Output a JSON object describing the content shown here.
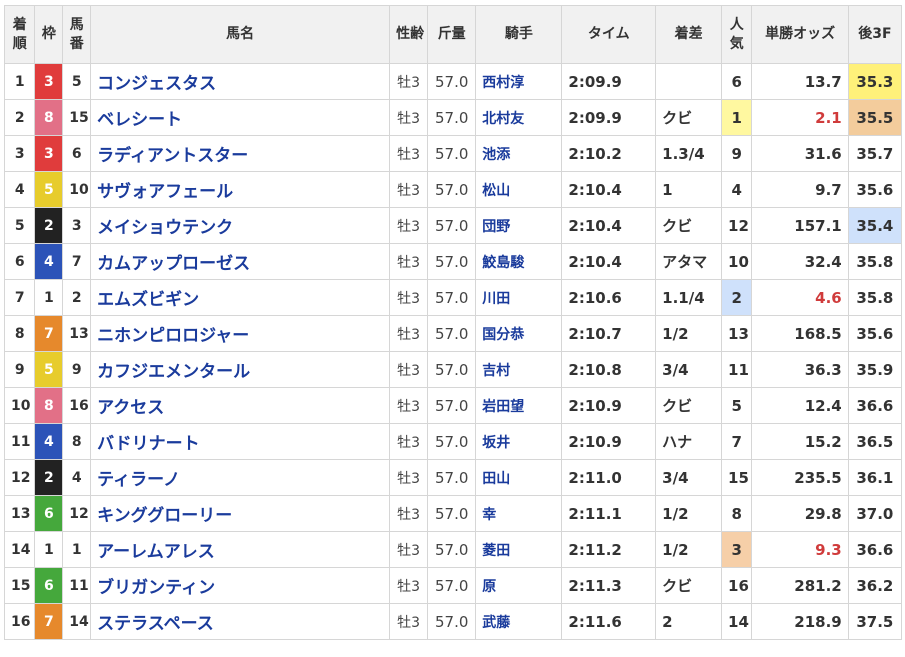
{
  "headers": {
    "rank": "着順",
    "waku": "枠",
    "num": "馬番",
    "name": "馬名",
    "sex_age": "性齢",
    "weight": "斤量",
    "jockey": "騎手",
    "time": "タイム",
    "margin": "着差",
    "popularity": "人気",
    "odds": "単勝オッズ",
    "last3f": "後3F"
  },
  "waku_colors": {
    "1": {
      "bg": "#ffffff",
      "fg": "#333333"
    },
    "2": {
      "bg": "#222222",
      "fg": "#ffffff"
    },
    "3": {
      "bg": "#e03c3c",
      "fg": "#ffffff"
    },
    "4": {
      "bg": "#2c53b8",
      "fg": "#ffffff"
    },
    "5": {
      "bg": "#e7cc2c",
      "fg": "#ffffff"
    },
    "6": {
      "bg": "#45a83c",
      "fg": "#ffffff"
    },
    "7": {
      "bg": "#e6892c",
      "fg": "#ffffff"
    },
    "8": {
      "bg": "#e27087",
      "fg": "#ffffff"
    }
  },
  "rows": [
    {
      "rank": "1",
      "waku": "3",
      "num": "5",
      "name": "コンジェスタス",
      "sex_age": "牡3",
      "weight": "57.0",
      "jockey": "西村淳",
      "time": "2:09.9",
      "margin": "",
      "popularity": "6",
      "odds": "13.7",
      "last3f": "35.3",
      "last_rank": 1
    },
    {
      "rank": "2",
      "waku": "8",
      "num": "15",
      "name": "ベレシート",
      "sex_age": "牡3",
      "weight": "57.0",
      "jockey": "北村友",
      "time": "2:09.9",
      "margin": "クビ",
      "popularity": "1",
      "odds": "2.1",
      "last3f": "35.5",
      "last_rank": 2
    },
    {
      "rank": "3",
      "waku": "3",
      "num": "6",
      "name": "ラディアントスター",
      "sex_age": "牡3",
      "weight": "57.0",
      "jockey": "池添",
      "time": "2:10.2",
      "margin": "1.3/4",
      "popularity": "9",
      "odds": "31.6",
      "last3f": "35.7",
      "last_rank": 0
    },
    {
      "rank": "4",
      "waku": "5",
      "num": "10",
      "name": "サヴォアフェール",
      "sex_age": "牡3",
      "weight": "57.0",
      "jockey": "松山",
      "time": "2:10.4",
      "margin": "1",
      "popularity": "4",
      "odds": "9.7",
      "last3f": "35.6",
      "last_rank": 0
    },
    {
      "rank": "5",
      "waku": "2",
      "num": "3",
      "name": "メイショウテンク",
      "sex_age": "牡3",
      "weight": "57.0",
      "jockey": "団野",
      "time": "2:10.4",
      "margin": "クビ",
      "popularity": "12",
      "odds": "157.1",
      "last3f": "35.4",
      "last_rank": 3
    },
    {
      "rank": "6",
      "waku": "4",
      "num": "7",
      "name": "カムアップローゼス",
      "sex_age": "牡3",
      "weight": "57.0",
      "jockey": "鮫島駿",
      "time": "2:10.4",
      "margin": "アタマ",
      "popularity": "10",
      "odds": "32.4",
      "last3f": "35.8",
      "last_rank": 0
    },
    {
      "rank": "7",
      "waku": "1",
      "num": "2",
      "name": "エムズビギン",
      "sex_age": "牡3",
      "weight": "57.0",
      "jockey": "川田",
      "time": "2:10.6",
      "margin": "1.1/4",
      "popularity": "2",
      "odds": "4.6",
      "last3f": "35.8",
      "last_rank": 0
    },
    {
      "rank": "8",
      "waku": "7",
      "num": "13",
      "name": "ニホンピロロジャー",
      "sex_age": "牡3",
      "weight": "57.0",
      "jockey": "国分恭",
      "time": "2:10.7",
      "margin": "1/2",
      "popularity": "13",
      "odds": "168.5",
      "last3f": "35.6",
      "last_rank": 0
    },
    {
      "rank": "9",
      "waku": "5",
      "num": "9",
      "name": "カフジエメンタール",
      "sex_age": "牡3",
      "weight": "57.0",
      "jockey": "吉村",
      "time": "2:10.8",
      "margin": "3/4",
      "popularity": "11",
      "odds": "36.3",
      "last3f": "35.9",
      "last_rank": 0
    },
    {
      "rank": "10",
      "waku": "8",
      "num": "16",
      "name": "アクセス",
      "sex_age": "牡3",
      "weight": "57.0",
      "jockey": "岩田望",
      "time": "2:10.9",
      "margin": "クビ",
      "popularity": "5",
      "odds": "12.4",
      "last3f": "36.6",
      "last_rank": 0
    },
    {
      "rank": "11",
      "waku": "4",
      "num": "8",
      "name": "バドリナート",
      "sex_age": "牡3",
      "weight": "57.0",
      "jockey": "坂井",
      "time": "2:10.9",
      "margin": "ハナ",
      "popularity": "7",
      "odds": "15.2",
      "last3f": "36.5",
      "last_rank": 0
    },
    {
      "rank": "12",
      "waku": "2",
      "num": "4",
      "name": "ティラーノ",
      "sex_age": "牡3",
      "weight": "57.0",
      "jockey": "田山",
      "time": "2:11.0",
      "margin": "3/4",
      "popularity": "15",
      "odds": "235.5",
      "last3f": "36.1",
      "last_rank": 0
    },
    {
      "rank": "13",
      "waku": "6",
      "num": "12",
      "name": "キンググローリー",
      "sex_age": "牡3",
      "weight": "57.0",
      "jockey": "幸",
      "time": "2:11.1",
      "margin": "1/2",
      "popularity": "8",
      "odds": "29.8",
      "last3f": "37.0",
      "last_rank": 0
    },
    {
      "rank": "14",
      "waku": "1",
      "num": "1",
      "name": "アーレムアレス",
      "sex_age": "牡3",
      "weight": "57.0",
      "jockey": "菱田",
      "time": "2:11.2",
      "margin": "1/2",
      "popularity": "3",
      "odds": "9.3",
      "last3f": "36.6",
      "last_rank": 0
    },
    {
      "rank": "15",
      "waku": "6",
      "num": "11",
      "name": "ブリガンティン",
      "sex_age": "牡3",
      "weight": "57.0",
      "jockey": "原",
      "time": "2:11.3",
      "margin": "クビ",
      "popularity": "16",
      "odds": "281.2",
      "last3f": "36.2",
      "last_rank": 0
    },
    {
      "rank": "16",
      "waku": "7",
      "num": "14",
      "name": "ステラスペース",
      "sex_age": "牡3",
      "weight": "57.0",
      "jockey": "武藤",
      "time": "2:11.6",
      "margin": "2",
      "popularity": "14",
      "odds": "218.9",
      "last3f": "37.5",
      "last_rank": 0
    }
  ]
}
